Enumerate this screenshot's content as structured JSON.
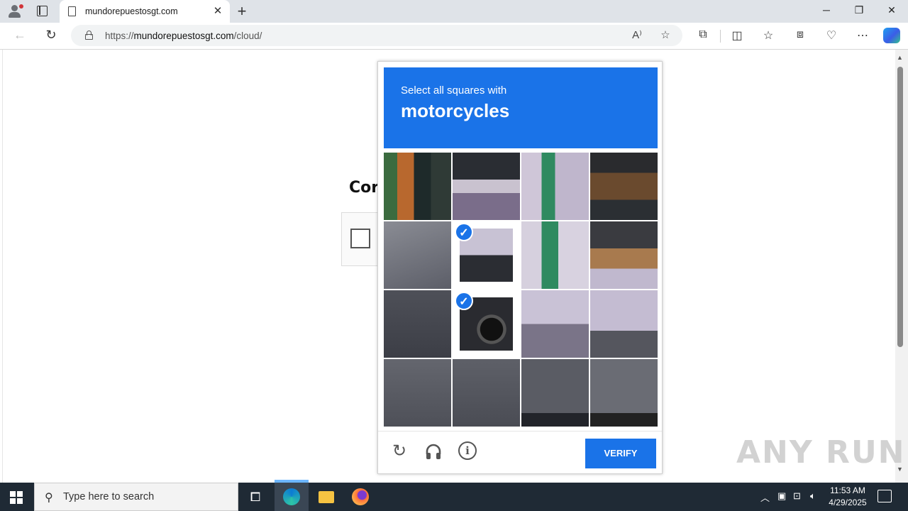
{
  "browser": {
    "tab_title": "mundorepuestosgt.com",
    "url_prefix": "https://",
    "url_domain": "mundorepuestosgt.com",
    "url_path": "/cloud/"
  },
  "page": {
    "heading": "Cor"
  },
  "captcha": {
    "instruction": "Select all squares with",
    "object": "motorcycles",
    "verify_label": "VERIFY",
    "tiles": [
      {
        "selected": false
      },
      {
        "selected": false
      },
      {
        "selected": false
      },
      {
        "selected": false
      },
      {
        "selected": false
      },
      {
        "selected": true
      },
      {
        "selected": false
      },
      {
        "selected": false
      },
      {
        "selected": false
      },
      {
        "selected": true
      },
      {
        "selected": false
      },
      {
        "selected": false
      },
      {
        "selected": false
      },
      {
        "selected": false
      },
      {
        "selected": false
      },
      {
        "selected": false
      }
    ],
    "accent_color": "#1a73e8"
  },
  "watermark": "ANY RUN",
  "taskbar": {
    "search_placeholder": "Type here to search",
    "time": "11:53 AM",
    "date": "4/29/2025"
  }
}
